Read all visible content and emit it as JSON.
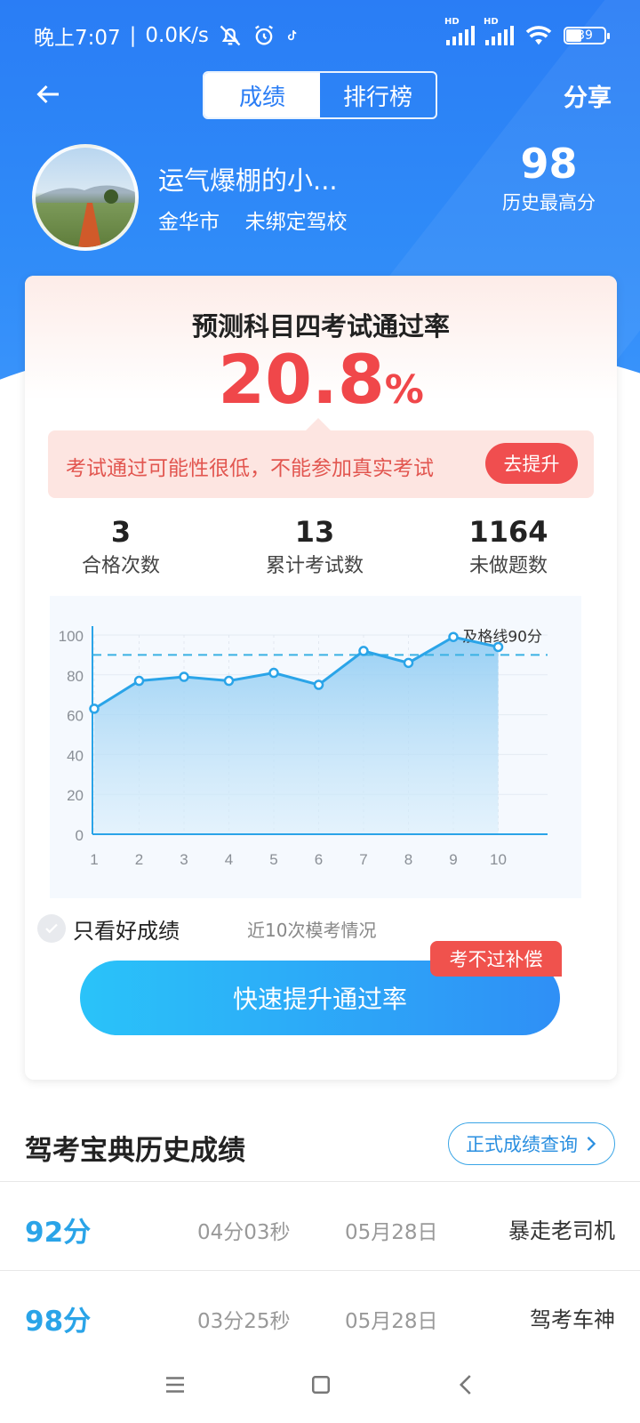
{
  "status_bar": {
    "time": "晚上7:07",
    "speed": "0.0K/s",
    "battery": "39"
  },
  "nav": {
    "tabs": [
      "成绩",
      "排行榜"
    ],
    "active_tab": "成绩",
    "share": "分享"
  },
  "profile": {
    "name": "运气爆棚的小...",
    "city": "金华市",
    "school": "未绑定驾校",
    "best_score": "98",
    "best_label": "历史最高分"
  },
  "prediction": {
    "title": "预测科目四考试通过率",
    "rate": "20.8",
    "unit": "%",
    "warning": "考试通过可能性很低，不能参加真实考试",
    "improve_button": "去提升"
  },
  "stats": [
    {
      "value": "3",
      "label": "合格次数"
    },
    {
      "value": "13",
      "label": "累计考试数"
    },
    {
      "value": "1164",
      "label": "未做题数"
    }
  ],
  "chart_data": {
    "type": "area",
    "x": [
      1,
      2,
      3,
      4,
      5,
      6,
      7,
      8,
      9,
      10
    ],
    "values": [
      63,
      77,
      79,
      77,
      81,
      75,
      92,
      86,
      99,
      94
    ],
    "ylim": [
      0,
      100
    ],
    "yticks": [
      0,
      20,
      40,
      60,
      80,
      100
    ],
    "pass_line": 90,
    "pass_label": "及格线90分",
    "color": "#2aa4e8"
  },
  "filter": {
    "label": "只看好成绩",
    "note": "近10次模考情况"
  },
  "cta": {
    "label": "快速提升通过率",
    "badge": "考不过补偿"
  },
  "history": {
    "title": "驾考宝典历史成绩",
    "link": "正式成绩查询",
    "rows": [
      {
        "score": "92分",
        "duration": "04分03秒",
        "date": "05月28日",
        "title": "暴走老司机"
      },
      {
        "score": "98分",
        "duration": "03分25秒",
        "date": "05月28日",
        "title": "驾考车神"
      }
    ]
  }
}
